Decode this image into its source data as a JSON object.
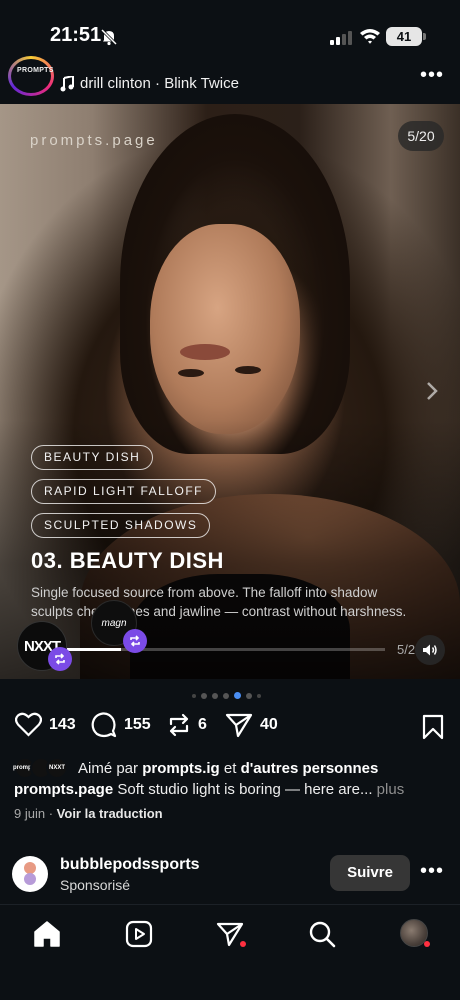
{
  "status_bar": {
    "time": "21:51",
    "battery": "41"
  },
  "post": {
    "avatar_text": "PROMPTS",
    "music": "drill clinton · Blink Twice",
    "media": {
      "brand": "prompts.page",
      "counter": "5/20",
      "tags": [
        "BEAUTY DISH",
        "RAPID LIGHT FALLOFF",
        "SCULPTED SHADOWS"
      ],
      "title": "03. BEAUTY DISH",
      "description": "Single focused source from above. The falloff into shadow sculpts cheekbones and jawline — contrast without harshness.",
      "collab_1": "NXXT",
      "collab_2": "magn",
      "page_num": "5/2",
      "progress": 0.17
    },
    "carousel": {
      "total_dots": 7,
      "active_index": 4
    },
    "actions": {
      "likes": "143",
      "comments": "155",
      "reposts": "6",
      "shares": "40"
    },
    "liked_by": {
      "prefix": "Aimé par",
      "user": "prompts.ig",
      "joiner": "et",
      "others": "d'autres personnes",
      "mini_1": "prompts",
      "mini_2": "",
      "mini_3": "NXXT"
    },
    "caption": {
      "user": "prompts.page",
      "text": "Soft studio light is boring — here are...",
      "more": "plus"
    },
    "meta": {
      "date": "9 juin",
      "separator": "·",
      "translate": "Voir la traduction"
    }
  },
  "next_post": {
    "name": "bubblepodssports",
    "sub": "Sponsorisé",
    "follow": "Suivre"
  },
  "colors": {
    "accent_badge": "#7b4be6",
    "active_dot": "#4a8ef3",
    "notification": "#ff3040"
  }
}
